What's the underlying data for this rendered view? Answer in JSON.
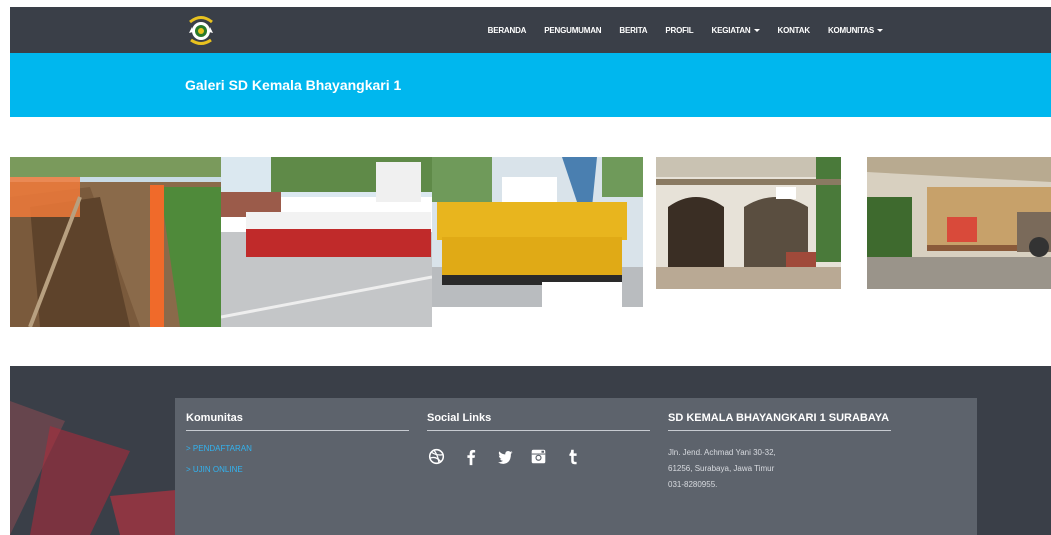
{
  "nav": {
    "items": [
      {
        "label": "BERANDA",
        "dropdown": false
      },
      {
        "label": "PENGUMUMAN",
        "dropdown": false
      },
      {
        "label": "BERITA",
        "dropdown": false
      },
      {
        "label": "PROFIL",
        "dropdown": false
      },
      {
        "label": "KEGIATAN",
        "dropdown": true
      },
      {
        "label": "KONTAK",
        "dropdown": false
      },
      {
        "label": "KOMUNITAS",
        "dropdown": true
      }
    ]
  },
  "banner": {
    "title": "Galeri SD Kemala Bhayangkari 1"
  },
  "colors": {
    "navbar": "#3a3f48",
    "banner": "#00b7ee",
    "footer_panel": "#5d636c",
    "link": "#32b3f0"
  },
  "footer": {
    "community": {
      "heading": "Komunitas",
      "links": [
        "> PENDAFTARAN",
        "> UJIN ONLINE"
      ]
    },
    "social": {
      "heading": "Social Links",
      "icons": [
        "dribbble-icon",
        "facebook-icon",
        "twitter-icon",
        "instagram-icon",
        "tumblr-icon"
      ]
    },
    "school": {
      "heading": "SD KEMALA BHAYANGKARI 1 SURABAYA",
      "address_line1": "Jln. Jend. Achmad Yani 30-32,",
      "address_line2": "61256, Surabaya, Jawa Timur",
      "phone": "031-8280955."
    }
  }
}
